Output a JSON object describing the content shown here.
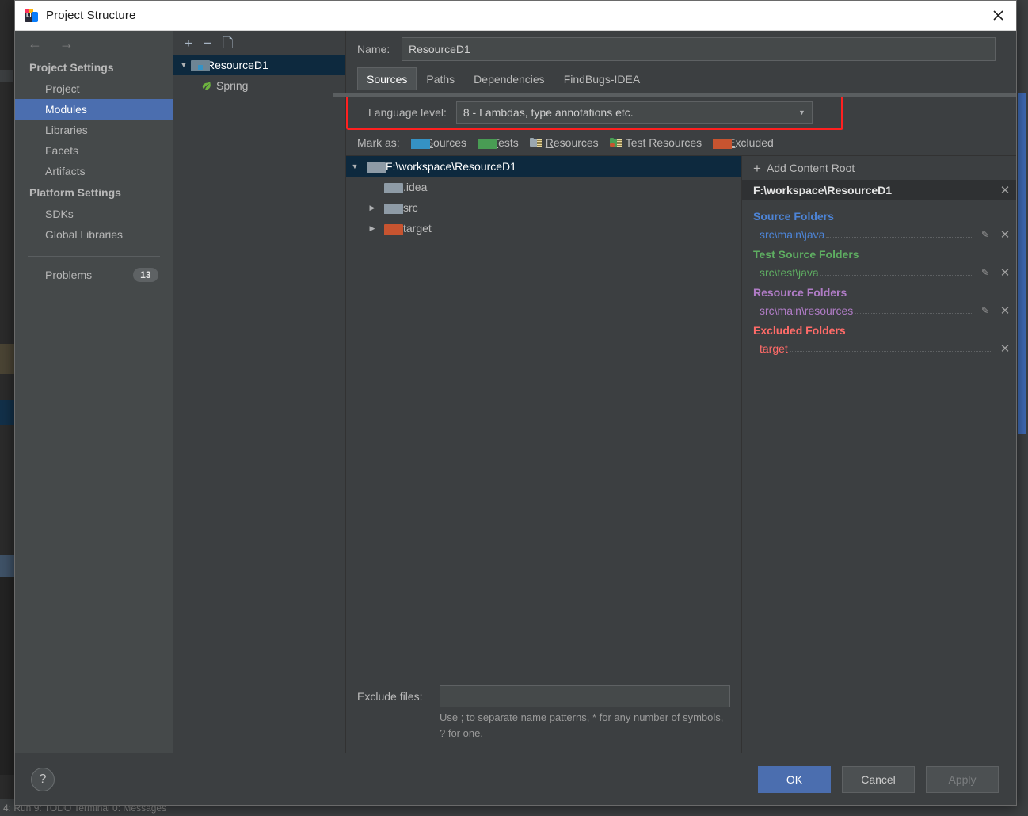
{
  "window": {
    "title": "Project Structure",
    "app_icon": "intellij-idea-icon",
    "close_icon": "close-icon"
  },
  "nav": {
    "back_icon": "arrow-left-icon",
    "forward_icon": "arrow-right-icon",
    "groups": [
      {
        "label": "Project Settings",
        "items": [
          {
            "label": "Project",
            "selected": false
          },
          {
            "label": "Modules",
            "selected": true
          },
          {
            "label": "Libraries",
            "selected": false
          },
          {
            "label": "Facets",
            "selected": false
          },
          {
            "label": "Artifacts",
            "selected": false
          }
        ]
      },
      {
        "label": "Platform Settings",
        "items": [
          {
            "label": "SDKs",
            "selected": false
          },
          {
            "label": "Global Libraries",
            "selected": false
          }
        ]
      }
    ],
    "problems": {
      "label": "Problems",
      "count": "13"
    }
  },
  "modules": {
    "toolbar": {
      "add_icon": "plus-icon",
      "remove_icon": "minus-icon",
      "copy_icon": "copy-icon"
    },
    "tree": [
      {
        "label": "ResourceD1",
        "icon": "module-folder-icon",
        "expanded": true,
        "selected": true,
        "depth": 0
      },
      {
        "label": "Spring",
        "icon": "spring-leaf-icon",
        "expanded": false,
        "selected": false,
        "depth": 1
      }
    ]
  },
  "main": {
    "name_label": "Name:",
    "name_value": "ResourceD1",
    "tabs": [
      {
        "label": "Sources",
        "active": true
      },
      {
        "label": "Paths",
        "active": false
      },
      {
        "label": "Dependencies",
        "active": false
      },
      {
        "label": "FindBugs-IDEA",
        "active": false
      }
    ],
    "language_level": {
      "label": "Language level:",
      "value": "8 - Lambdas, type annotations etc.",
      "caret_icon": "chevron-down-icon",
      "highlight_color": "#ff2020"
    },
    "mark_as": {
      "label": "Mark as:",
      "options": [
        {
          "label": "Sources",
          "mnemonic": "S",
          "icon": "folder-sources-icon",
          "color": "#3592c4"
        },
        {
          "label": "Tests",
          "mnemonic": "T",
          "icon": "folder-tests-icon",
          "color": "#499c54"
        },
        {
          "label": "Resources",
          "mnemonic": "R",
          "icon": "folder-resources-icon",
          "color": "#9aa7b0"
        },
        {
          "label": "Test Resources",
          "mnemonic": "",
          "icon": "folder-test-resources-icon",
          "color": "#499c54"
        },
        {
          "label": "Excluded",
          "mnemonic": "E",
          "icon": "folder-excluded-icon",
          "color": "#c75430"
        }
      ]
    },
    "file_tree": [
      {
        "label": "F:\\workspace\\ResourceD1",
        "depth": 0,
        "expanded": true,
        "has_children": true,
        "selected": true,
        "color": "#8e9ba6"
      },
      {
        "label": ".idea",
        "depth": 1,
        "expanded": false,
        "has_children": false,
        "selected": false,
        "color": "#8e9ba6"
      },
      {
        "label": "src",
        "depth": 1,
        "expanded": false,
        "has_children": true,
        "selected": false,
        "color": "#8e9ba6"
      },
      {
        "label": "target",
        "depth": 1,
        "expanded": false,
        "has_children": true,
        "selected": false,
        "color": "#c75430"
      }
    ],
    "exclude": {
      "label": "Exclude files:",
      "value": "",
      "hint": "Use ; to separate name patterns, * for any number of symbols, ? for one."
    }
  },
  "roots": {
    "add_content_root": {
      "label_prefix": "Add ",
      "label_mnemonic": "C",
      "label_suffix": "ontent Root",
      "icon": "plus-icon"
    },
    "content_root_path": "F:\\workspace\\ResourceD1",
    "remove_root_icon": "close-icon",
    "groups": [
      {
        "title": "Source Folders",
        "color": "#4d84d6",
        "items": [
          {
            "path": "src\\main\\java",
            "has_edit": true,
            "edit_icon": "pencil-icon",
            "remove_icon": "close-icon"
          }
        ]
      },
      {
        "title": "Test Source Folders",
        "color": "#5ead61",
        "items": [
          {
            "path": "src\\test\\java",
            "has_edit": true,
            "edit_icon": "pencil-icon",
            "remove_icon": "close-icon"
          }
        ]
      },
      {
        "title": "Resource Folders",
        "color": "#b07cc6",
        "items": [
          {
            "path": "src\\main\\resources",
            "has_edit": true,
            "edit_icon": "pencil-icon",
            "remove_icon": "close-icon"
          }
        ]
      },
      {
        "title": "Excluded Folders",
        "color": "#ff6b68",
        "items": [
          {
            "path": "target",
            "has_edit": false,
            "edit_icon": "",
            "remove_icon": "close-icon"
          }
        ]
      }
    ]
  },
  "footer": {
    "help_label": "?",
    "ok_label": "OK",
    "cancel_label": "Cancel",
    "apply_label": "Apply"
  },
  "background": {
    "statusbar_text": "4: Run        9: TODO        Terminal        0: Messages"
  }
}
